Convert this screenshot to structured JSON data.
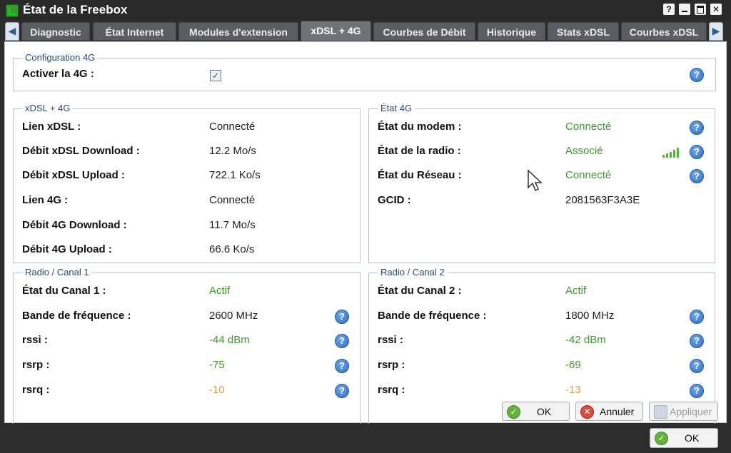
{
  "window": {
    "title": "État de la Freebox",
    "controls": {
      "help": "?"
    }
  },
  "tabs": [
    {
      "label": "Diagnostic"
    },
    {
      "label": "État Internet"
    },
    {
      "label": "Modules d'extension"
    },
    {
      "label": "xDSL + 4G",
      "active": true
    },
    {
      "label": "Courbes de Débit"
    },
    {
      "label": "Historique"
    },
    {
      "label": "Stats xDSL"
    },
    {
      "label": "Courbes xDSL"
    }
  ],
  "config4g": {
    "legend": "Configuration 4G",
    "activate_label": "Activer la 4G :",
    "activate_checked": true,
    "check_mark": "✓"
  },
  "xdsl4g": {
    "legend": "xDSL + 4G",
    "rows": [
      {
        "label": "Lien xDSL :",
        "value": "Connecté"
      },
      {
        "label": "Débit xDSL Download :",
        "value": "12.2 Mo/s"
      },
      {
        "label": "Débit xDSL Upload :",
        "value": "722.1 Ko/s"
      },
      {
        "label": "Lien 4G :",
        "value": "Connecté"
      },
      {
        "label": "Débit 4G Download :",
        "value": "11.7 Mo/s"
      },
      {
        "label": "Débit 4G Upload :",
        "value": "66.6 Ko/s"
      }
    ]
  },
  "etat4g": {
    "legend": "État 4G",
    "rows": [
      {
        "label": "État du modem :",
        "value": "Connecté"
      },
      {
        "label": "État de la radio :",
        "value": "Associé"
      },
      {
        "label": "État du Réseau :",
        "value": "Connecté"
      },
      {
        "label": "GCID :",
        "value": "2081563F3A3E"
      }
    ]
  },
  "canal1": {
    "legend": "Radio / Canal 1",
    "rows": [
      {
        "label": "État du Canal 1 :",
        "value": "Actif"
      },
      {
        "label": "Bande de fréquence :",
        "value": "2600 MHz"
      },
      {
        "label": "rssi :",
        "value": "-44 dBm"
      },
      {
        "label": "rsrp :",
        "value": "-75"
      },
      {
        "label": "rsrq :",
        "value": "-10"
      }
    ]
  },
  "canal2": {
    "legend": "Radio / Canal 2",
    "rows": [
      {
        "label": "État du Canal 2 :",
        "value": "Actif"
      },
      {
        "label": "Bande de fréquence :",
        "value": "1800 MHz"
      },
      {
        "label": "rssi :",
        "value": "-42 dBm"
      },
      {
        "label": "rsrp :",
        "value": "-69"
      },
      {
        "label": "rsrq :",
        "value": "-13"
      }
    ]
  },
  "help_glyph": "?",
  "buttons": {
    "ok": "OK",
    "cancel": "Annuler",
    "apply": "Appliquer",
    "window_ok": "OK"
  },
  "colors": {
    "status_green": "#3c9a2c",
    "warning_orange": "#e79b33"
  }
}
